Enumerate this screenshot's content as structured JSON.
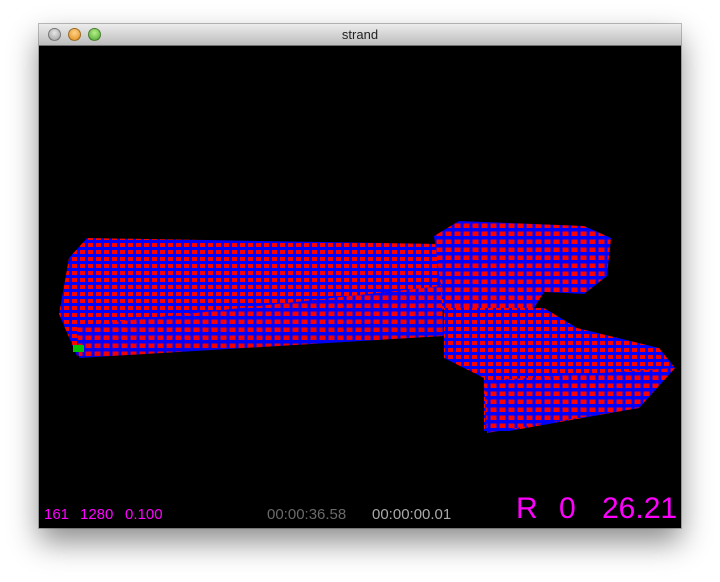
{
  "window": {
    "title": "strand"
  },
  "hud": {
    "stat_a": "161",
    "stat_b": "1280",
    "stat_c": "0.100",
    "elapsed_total": "00:00:36.58",
    "elapsed_step": "00:00:00.01",
    "mode": "R",
    "mode_value": "0",
    "fps": "26.21"
  },
  "colors": {
    "cube_fill": "#ff0000",
    "cube_edge": "#0000ff",
    "seed_cube": "#00c000",
    "hud_accent": "#ff00ff"
  }
}
